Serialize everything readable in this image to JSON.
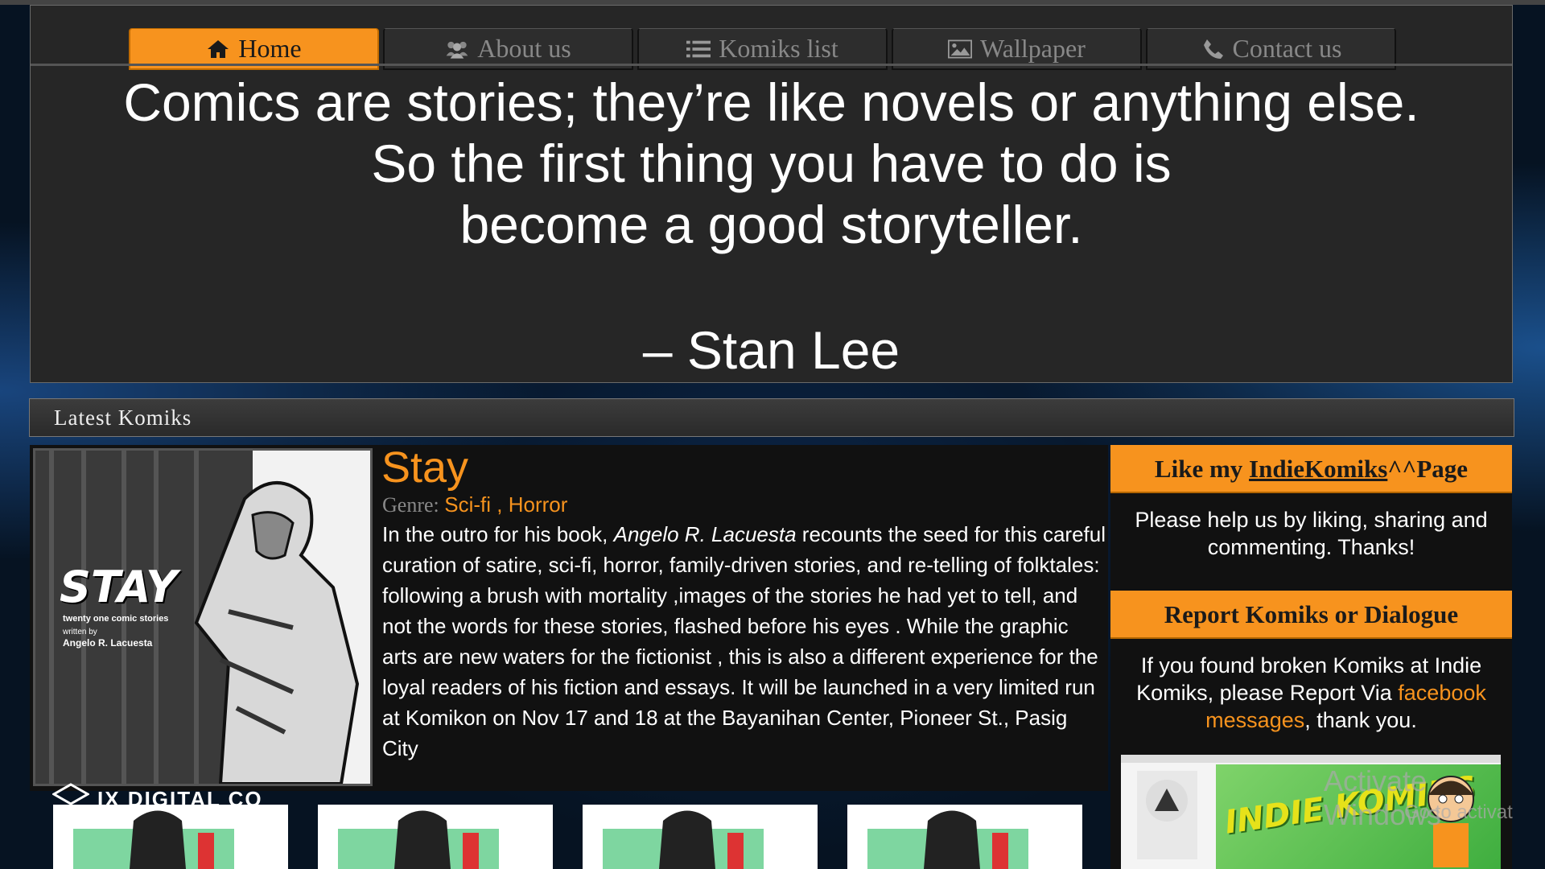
{
  "nav": {
    "items": [
      {
        "label": "Home",
        "icon": "home-icon",
        "active": true
      },
      {
        "label": "About us",
        "icon": "users-icon",
        "active": false
      },
      {
        "label": "Komiks list",
        "icon": "list-icon",
        "active": false
      },
      {
        "label": "Wallpaper",
        "icon": "image-icon",
        "active": false
      },
      {
        "label": "Contact us",
        "icon": "phone-icon",
        "active": false
      }
    ]
  },
  "quote": {
    "lines": [
      "Comics are stories; they’re like novels or anything else.",
      "So the first thing you have to do is",
      "become a good storyteller."
    ],
    "author": "– Stan Lee"
  },
  "section": {
    "title": "Latest Komiks"
  },
  "komik": {
    "title": "Stay",
    "genre_label": "Genre:",
    "genres": [
      "Sci-fi",
      "Horror"
    ],
    "genre_separator": " , ",
    "desc_before": "In the outro for his book, ",
    "author": "Angelo R. Lacuesta",
    "desc_after": " recounts the seed for this careful curation of satire, sci-fi, horror, family-driven stories, and re-telling of folktales: following a brush with mortality ,images of the stories he had yet to tell, and not the words for these stories, flashed before his eyes . While the graphic arts are new waters for the fictionist , this is also a different experience for the loyal readers of his fiction and essays. It will be launched in a very limited run at Komikon on Nov 17 and 18 at the Bayanihan Center, Pioneer St., Pasig City",
    "cover_title": "STAY",
    "cover_subtitle": "twenty one comic stories",
    "cover_credit_1": "written by",
    "cover_credit_2": "Angelo R. Lacuesta"
  },
  "sidebar": {
    "like": {
      "prefix": "Like my ",
      "link": "IndieKomiks",
      "suffix": "^^Page",
      "text": "Please help us by liking, sharing and commenting. Thanks!"
    },
    "report": {
      "title": "Report Komiks or Dialogue",
      "text_before": "If you found broken Komiks at Indie Komiks, please Report Via ",
      "link": "facebook messages",
      "text_after": ", thank you."
    },
    "fb_banner_text": "INDIE KOMIKS"
  },
  "watermark": "IX DIGITAL CO",
  "activate": {
    "line1": "Activate Windows",
    "line2": "Go to activat"
  },
  "colors": {
    "accent": "#f7931e",
    "panel": "#262626",
    "background": "#061322"
  }
}
